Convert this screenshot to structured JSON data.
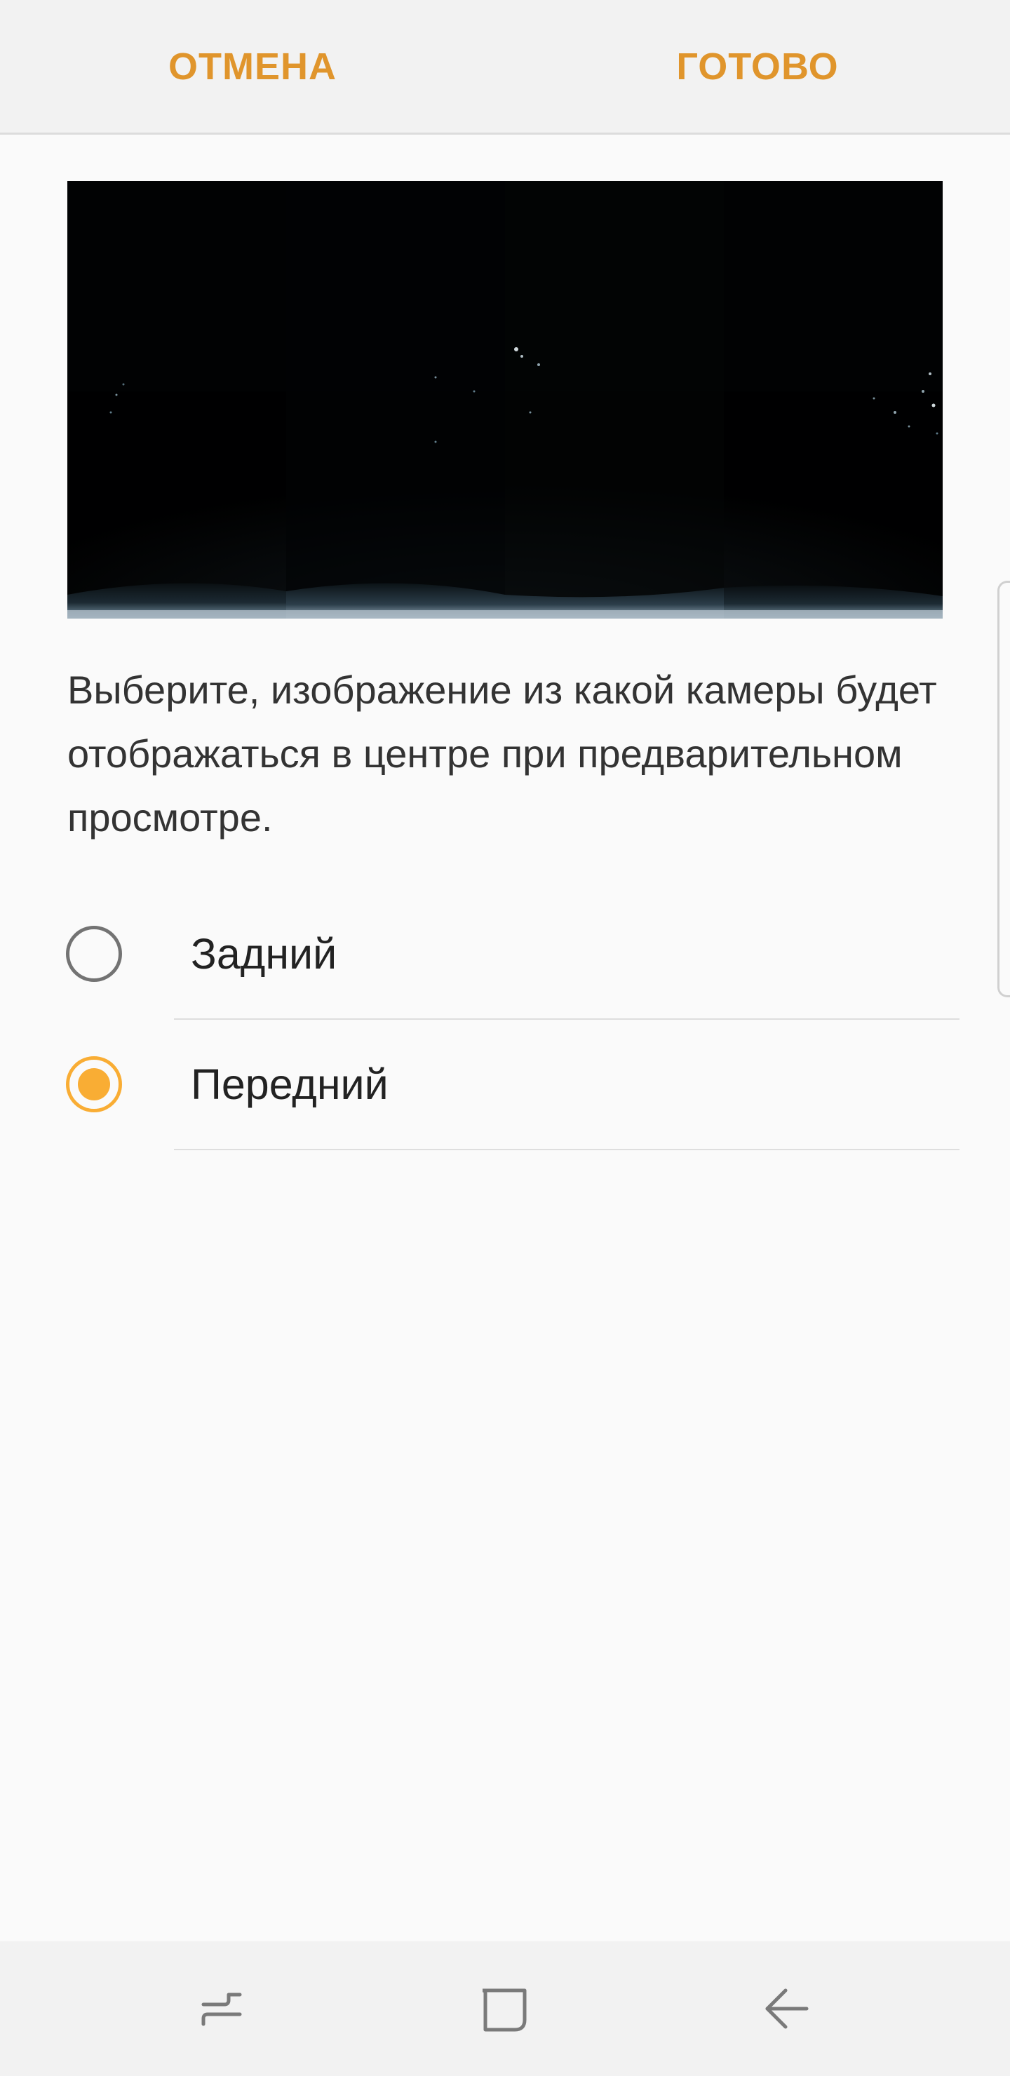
{
  "colors": {
    "accent": "#e0952c",
    "accent_radio": "#f9ad34",
    "background": "#fafafa",
    "bar_background": "#f2f2f2"
  },
  "toolbar": {
    "cancel_label": "ОТМЕНА",
    "done_label": "ГОТОВО"
  },
  "preview": {
    "icon": "panorama-preview-image"
  },
  "description": "Выберите, изображение из какой камеры будет отображаться в центре при предварительном просмотре.",
  "options": [
    {
      "label": "Задний",
      "selected": false
    },
    {
      "label": "Передний",
      "selected": true
    }
  ],
  "nav": {
    "recent_icon": "recent-apps-icon",
    "home_icon": "home-icon",
    "back_icon": "back-icon"
  }
}
